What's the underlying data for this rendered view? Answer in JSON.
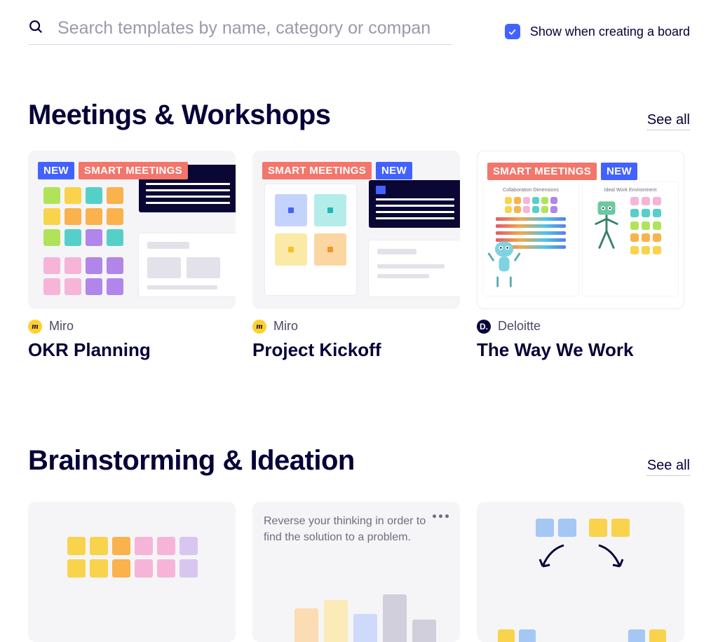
{
  "search": {
    "placeholder": "Search templates by name, category or compan"
  },
  "show_toggle": {
    "checked": true,
    "label": "Show when creating a board"
  },
  "badges": {
    "new": "NEW",
    "smart": "SMART MEETINGS"
  },
  "sections": [
    {
      "id": "meetings",
      "title": "Meetings & Workshops",
      "see_all": "See all",
      "cards": [
        {
          "publisher": "Miro",
          "publisher_icon": "miro",
          "title": "OKR Planning",
          "badges": [
            "new",
            "smart"
          ]
        },
        {
          "publisher": "Miro",
          "publisher_icon": "miro",
          "title": "Project Kickoff",
          "badges": [
            "smart",
            "new"
          ]
        },
        {
          "publisher": "Deloitte",
          "publisher_icon": "deloitte",
          "title": "The Way We Work",
          "badges": [
            "smart",
            "new"
          ]
        }
      ]
    },
    {
      "id": "brainstorming",
      "title": "Brainstorming & Ideation",
      "see_all": "See all",
      "cards": [
        {
          "title": ""
        },
        {
          "title": "",
          "prompt": "Reverse your thinking in order to find the solution to a problem."
        },
        {
          "title": ""
        }
      ]
    }
  ],
  "publisher_glyph": {
    "miro": "m",
    "deloitte": "D."
  }
}
